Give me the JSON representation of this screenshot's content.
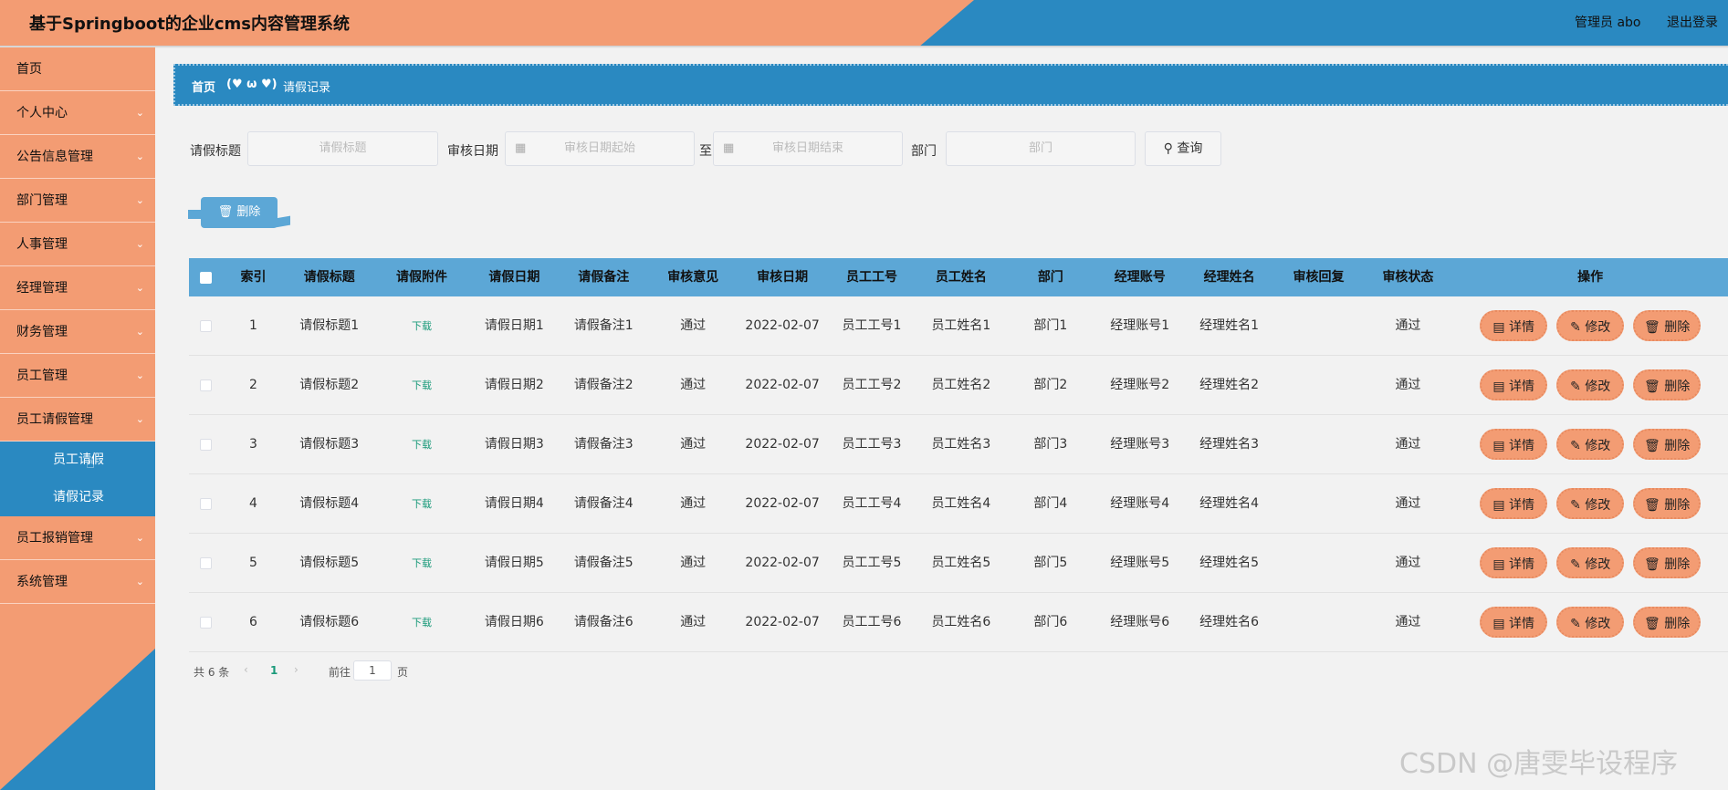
{
  "header": {
    "title": "基于Springboot的企业cms内容管理系统",
    "admin": "管理员 abo",
    "logout": "退出登录"
  },
  "sidebar": {
    "items": [
      {
        "label": "首页",
        "has_children": false
      },
      {
        "label": "个人中心",
        "has_children": true
      },
      {
        "label": "公告信息管理",
        "has_children": true
      },
      {
        "label": "部门管理",
        "has_children": true
      },
      {
        "label": "人事管理",
        "has_children": true
      },
      {
        "label": "经理管理",
        "has_children": true
      },
      {
        "label": "财务管理",
        "has_children": true
      },
      {
        "label": "员工管理",
        "has_children": true
      },
      {
        "label": "员工请假管理",
        "has_children": true,
        "expanded": true,
        "children": [
          "员工请假",
          "请假记录"
        ]
      },
      {
        "label": "员工报销管理",
        "has_children": true
      },
      {
        "label": "系统管理",
        "has_children": true
      }
    ]
  },
  "breadcrumb": {
    "home": "首页",
    "separator": "(♥ ω ♥)",
    "current": "请假记录"
  },
  "search": {
    "title_label": "请假标题",
    "title_placeholder": "请假标题",
    "date_label": "审核日期",
    "date_start_placeholder": "审核日期起始",
    "to": "至",
    "date_end_placeholder": "审核日期结束",
    "dept_label": "部门",
    "dept_placeholder": "部门",
    "query_button": "查询"
  },
  "toolbar": {
    "delete_button": "删除"
  },
  "table": {
    "columns": [
      "索引",
      "请假标题",
      "请假附件",
      "请假日期",
      "请假备注",
      "审核意见",
      "审核日期",
      "员工工号",
      "员工姓名",
      "部门",
      "经理账号",
      "经理姓名",
      "审核回复",
      "审核状态",
      "操作"
    ],
    "rows": [
      [
        "1",
        "请假标题1",
        "下载",
        "请假日期1",
        "请假备注1",
        "通过",
        "2022-02-07",
        "员工工号1",
        "员工姓名1",
        "部门1",
        "经理账号1",
        "经理姓名1",
        "",
        "通过"
      ],
      [
        "2",
        "请假标题2",
        "下载",
        "请假日期2",
        "请假备注2",
        "通过",
        "2022-02-07",
        "员工工号2",
        "员工姓名2",
        "部门2",
        "经理账号2",
        "经理姓名2",
        "",
        "通过"
      ],
      [
        "3",
        "请假标题3",
        "下载",
        "请假日期3",
        "请假备注3",
        "通过",
        "2022-02-07",
        "员工工号3",
        "员工姓名3",
        "部门3",
        "经理账号3",
        "经理姓名3",
        "",
        "通过"
      ],
      [
        "4",
        "请假标题4",
        "下载",
        "请假日期4",
        "请假备注4",
        "通过",
        "2022-02-07",
        "员工工号4",
        "员工姓名4",
        "部门4",
        "经理账号4",
        "经理姓名4",
        "",
        "通过"
      ],
      [
        "5",
        "请假标题5",
        "下载",
        "请假日期5",
        "请假备注5",
        "通过",
        "2022-02-07",
        "员工工号5",
        "员工姓名5",
        "部门5",
        "经理账号5",
        "经理姓名5",
        "",
        "通过"
      ],
      [
        "6",
        "请假标题6",
        "下载",
        "请假日期6",
        "请假备注6",
        "通过",
        "2022-02-07",
        "员工工号6",
        "员工姓名6",
        "部门6",
        "经理账号6",
        "经理姓名6",
        "",
        "通过"
      ]
    ],
    "actions": [
      "详情",
      "修改",
      "删除"
    ]
  },
  "pagination": {
    "total": "共 6 条",
    "current_page": "1",
    "goto_label": "前往",
    "goto_value": "1",
    "page_suffix": "页"
  },
  "watermark": "CSDN @唐雯毕设程序",
  "icons": {
    "calendar": "calendar-icon",
    "search": "search-icon",
    "trash": "trash-icon",
    "document": "document-icon",
    "edit": "edit-icon",
    "chevron": "chevron-down-icon"
  },
  "colors": {
    "primary_blue": "#2a89c1",
    "accent_orange": "#f39c73",
    "table_header": "#5ca7d6"
  }
}
